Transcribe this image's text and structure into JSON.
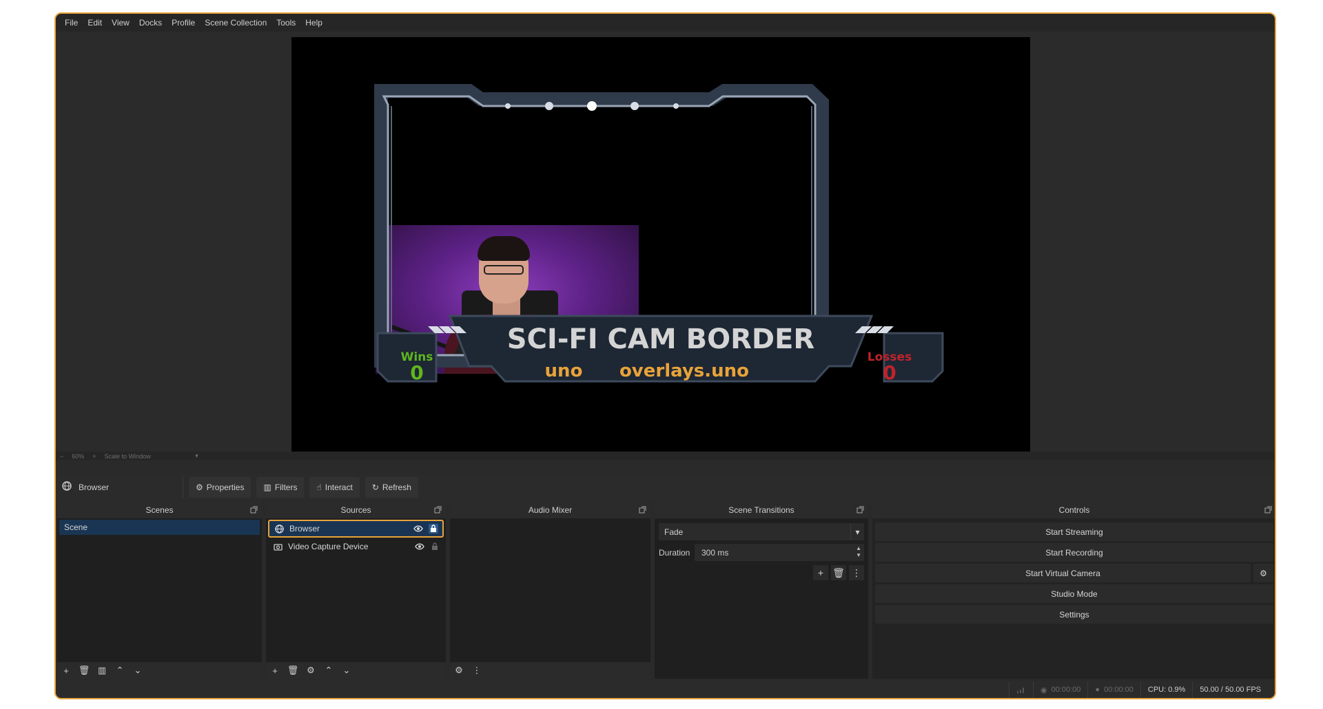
{
  "menu": [
    "File",
    "Edit",
    "View",
    "Docks",
    "Profile",
    "Scene Collection",
    "Tools",
    "Help"
  ],
  "preview": {
    "overlay_title": "SCI-FI CAM BORDER",
    "wins_label": "Wins",
    "wins_value": "0",
    "losses_label": "Losses",
    "losses_value": "0",
    "brand_logo": "uno",
    "brand_text": "overlays.uno"
  },
  "zoombar": {
    "minus": "−",
    "zoom": "60%",
    "plus": "+",
    "scale_mode": "Scale to Window"
  },
  "source_toolbar": {
    "selected_source": "Browser",
    "properties": "Properties",
    "filters": "Filters",
    "interact": "Interact",
    "refresh": "Refresh"
  },
  "docks": {
    "scenes": {
      "title": "Scenes",
      "items": [
        "Scene"
      ]
    },
    "sources": {
      "title": "Sources",
      "items": [
        {
          "name": "Browser",
          "icon": "globe-icon"
        },
        {
          "name": "Video Capture Device",
          "icon": "camera-icon"
        }
      ]
    },
    "audio_mixer": {
      "title": "Audio Mixer"
    },
    "transitions": {
      "title": "Scene Transitions",
      "selected": "Fade",
      "duration_label": "Duration",
      "duration_value": "300 ms"
    },
    "controls": {
      "title": "Controls",
      "start_streaming": "Start Streaming",
      "start_recording": "Start Recording",
      "start_virtual_camera": "Start Virtual Camera",
      "studio_mode": "Studio Mode",
      "settings": "Settings"
    }
  },
  "status": {
    "stream_time": "00:00:00",
    "rec_time": "00:00:00",
    "cpu": "CPU: 0.9%",
    "fps": "50.00 / 50.00 FPS"
  },
  "colors": {
    "accent": "#e8a33a",
    "selection": "#1a3554",
    "wins": "#5fb61e",
    "losses": "#c0232b",
    "brand": "#e8a33a"
  }
}
